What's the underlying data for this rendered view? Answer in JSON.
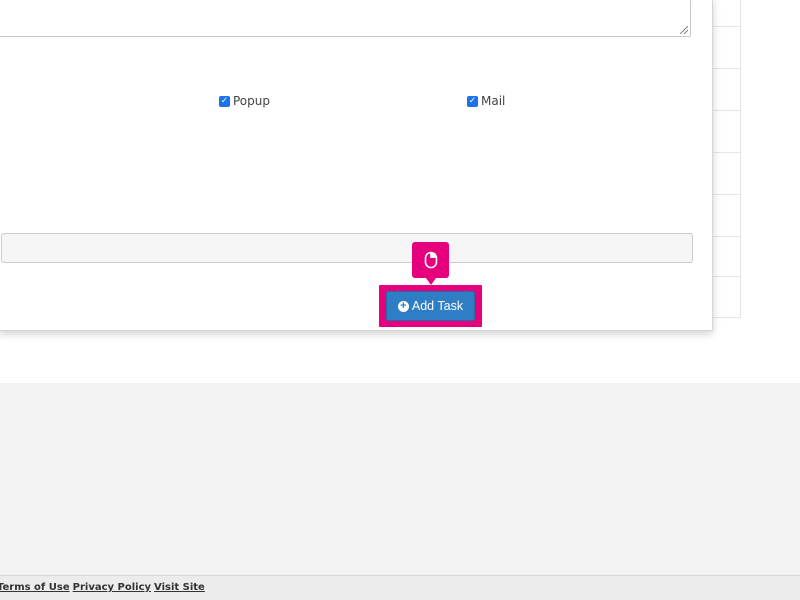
{
  "form": {
    "checkbox_popup": "Popup",
    "checkbox_mail": "Mail",
    "add_task_label": "Add Task"
  },
  "footer": {
    "links": [
      "Terms of Use",
      "Privacy Policy",
      "Visit Site"
    ]
  },
  "colors": {
    "highlight": "#e6007e",
    "primary_button": "#2d7ec4"
  },
  "icons": {
    "cursor": "mouse-icon",
    "add": "plus-circle-icon",
    "checkbox": "checkmark-icon"
  }
}
